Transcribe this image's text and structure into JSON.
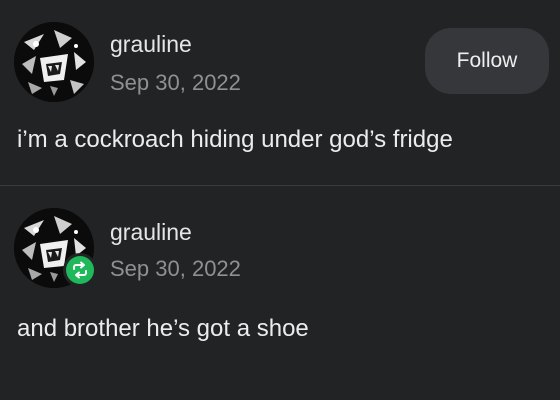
{
  "posts": [
    {
      "username": "grauline",
      "date": "Sep 30, 2022",
      "text": "i’m a cockroach hiding under god’s fridge",
      "follow_label": "Follow",
      "avatar_icon": "avatar-face-icon"
    },
    {
      "username": "grauline",
      "date": "Sep 30, 2022",
      "text": "and brother he’s got a shoe",
      "avatar_icon": "avatar-face-icon",
      "badge_icon": "reblog-icon",
      "badge_color": "#1fb85a"
    }
  ],
  "colors": {
    "background": "#222325",
    "button_bg": "#36373a",
    "muted_text": "#8f9094",
    "reblog_green": "#1fb85a"
  }
}
